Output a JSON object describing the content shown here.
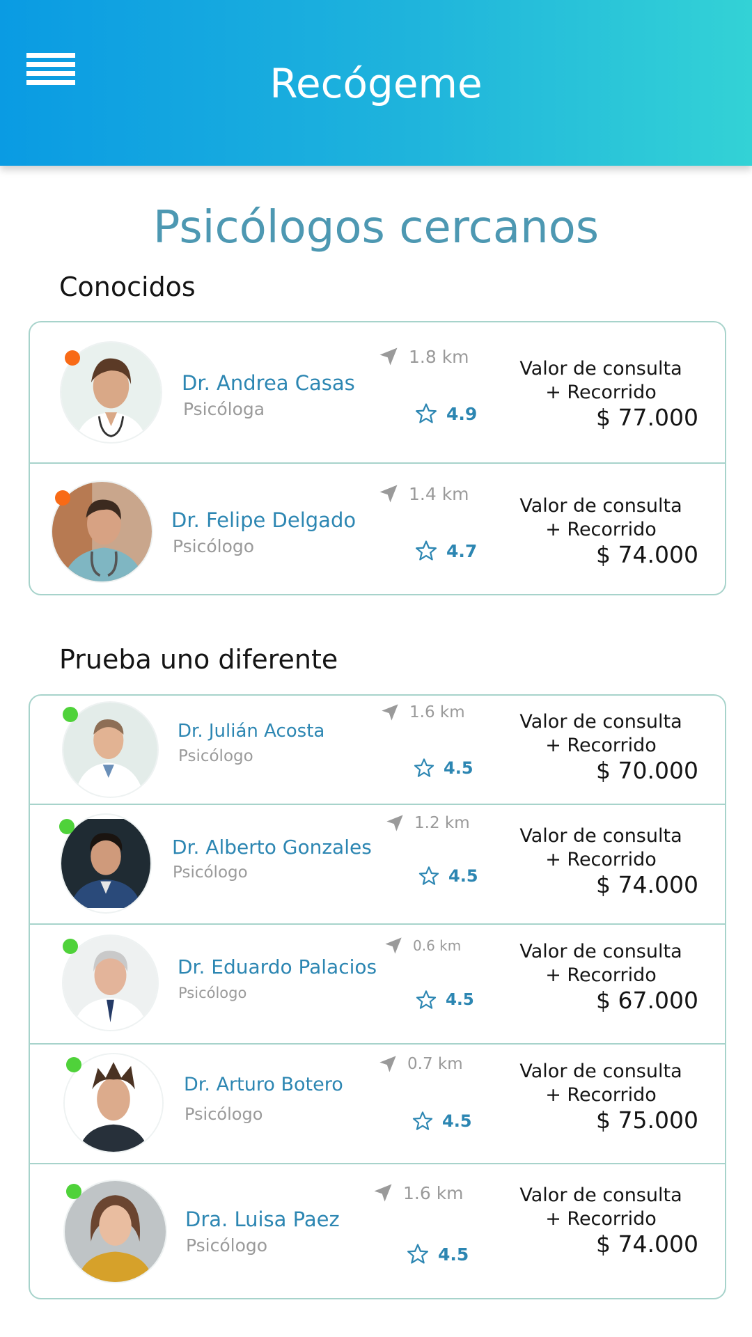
{
  "app": {
    "title": "Recógeme"
  },
  "page": {
    "title": "Psicólogos cercanos"
  },
  "sections": {
    "known": {
      "title": "Conocidos"
    },
    "different": {
      "title": "Prueba uno diferente"
    }
  },
  "price_labels": {
    "line1": "Valor de consulta",
    "line2": "+ Recorrido"
  },
  "colors": {
    "accent": "#2c86b2",
    "header_start": "#0a9be3",
    "header_end": "#33d2d6",
    "busy": "#f86a16",
    "online": "#4fd23a",
    "border": "#a7d3cb"
  },
  "known_doctors": [
    {
      "name": "Dr. Andrea Casas",
      "role": "Psicóloga",
      "distance": "1.8 km",
      "rating": "4.9",
      "price": "$ 77.000",
      "status": "busy"
    },
    {
      "name": "Dr. Felipe Delgado",
      "role": "Psicólogo",
      "distance": "1.4 km",
      "rating": "4.7",
      "price": "$ 74.000",
      "status": "busy"
    }
  ],
  "other_doctors": [
    {
      "name": "Dr. Julián Acosta",
      "role": "Psicólogo",
      "distance": "1.6 km",
      "rating": "4.5",
      "price": "$ 70.000",
      "status": "online"
    },
    {
      "name": "Dr. Alberto Gonzales",
      "role": "Psicólogo",
      "distance": "1.2 km",
      "rating": "4.5",
      "price": "$ 74.000",
      "status": "online"
    },
    {
      "name": "Dr. Eduardo Palacios",
      "role": "Psicólogo",
      "distance": "0.6 km",
      "rating": "4.5",
      "price": "$ 67.000",
      "status": "online"
    },
    {
      "name": "Dr. Arturo Botero",
      "role": "Psicólogo",
      "distance": "0.7 km",
      "rating": "4.5",
      "price": "$ 75.000",
      "status": "online"
    },
    {
      "name": "Dra. Luisa Paez",
      "role": "Psicólogo",
      "distance": "1.6 km",
      "rating": "4.5",
      "price": "$ 74.000",
      "status": "online"
    }
  ]
}
